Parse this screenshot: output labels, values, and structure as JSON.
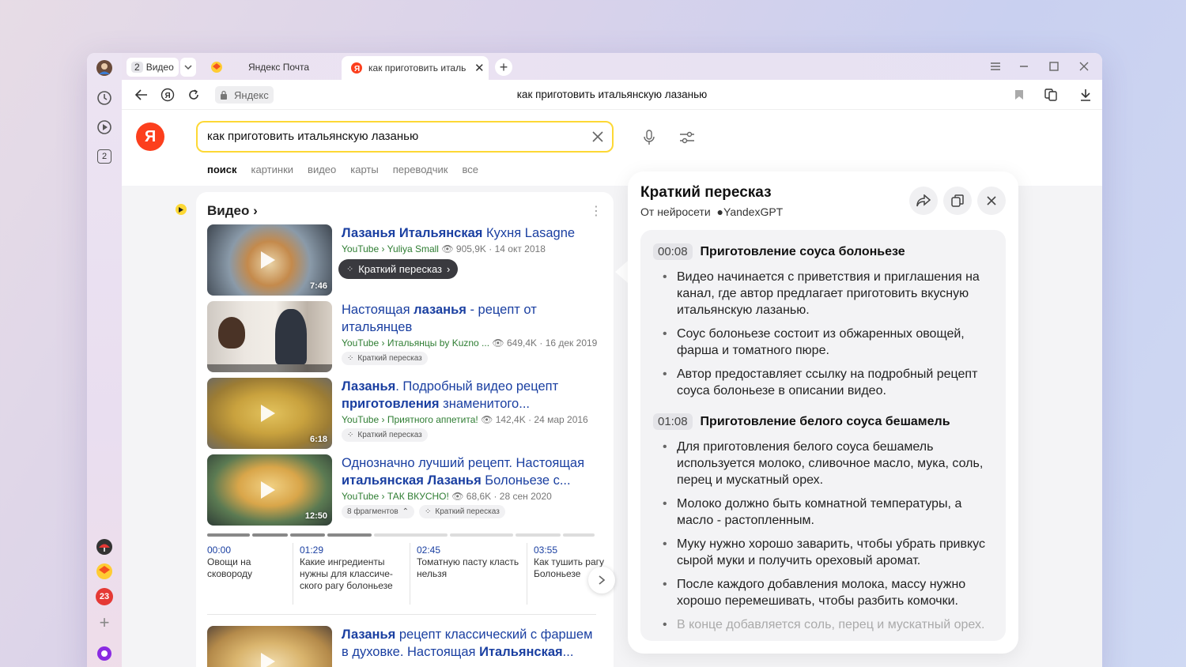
{
  "tabs": {
    "group_count": "2",
    "group_label": "Видео",
    "mail_label": "Яндекс Почта",
    "active_label": "как приготовить италь"
  },
  "address": {
    "site_label": "Яндекс",
    "query_title": "как приготовить итальянскую лазанью"
  },
  "rail": {
    "tab_count": "2",
    "badge_count": "23"
  },
  "search": {
    "value": "как приготовить итальянскую лазанью",
    "tabs": [
      "поиск",
      "картинки",
      "видео",
      "карты",
      "переводчик",
      "все"
    ]
  },
  "videos": {
    "header": "Видео",
    "items": [
      {
        "title_bold": "Лазанья Итальянская",
        "title_rest": " Кухня Lasagne",
        "source": "YouTube › Yuliya Small",
        "views": "905,9K",
        "date": "14 окт 2018",
        "duration": "7:46",
        "summary_label": "Краткий пересказ"
      },
      {
        "title_pre": "Настоящая ",
        "title_bold": "лазанья",
        "title_rest": " - рецепт от итальянцев",
        "source": "YouTube › Итальянцы by Kuzno ...",
        "views": "649,4K",
        "date": "16 дек 2019",
        "summary_label": "Краткий пересказ"
      },
      {
        "title_bold": "Лазанья",
        "title_rest": ". Подробный видео рецепт ",
        "title_bold2": "приготовления",
        "title_rest2": " знаменитого...",
        "source": "YouTube › Приятного аппетита!",
        "views": "142,4K",
        "date": "24 мар 2016",
        "duration": "6:18",
        "summary_label": "Краткий пересказ"
      },
      {
        "title_pre": "Однозначно лучший рецепт. Настоящая ",
        "title_bold": "итальянская Лазанья",
        "title_rest": " Болоньезе с...",
        "source": "YouTube › ТАК ВКУСНО!",
        "views": "68,6K",
        "date": "28 сен 2020",
        "duration": "12:50",
        "fragments_label": "8 фрагментов",
        "summary_label": "Краткий пересказ"
      },
      {
        "title_bold": "Лазанья",
        "title_rest": " рецепт классический с фаршем в духовке. Настоящая ",
        "title_bold2": "Итальянская",
        "title_rest2": "..."
      }
    ],
    "fragments": [
      {
        "time": "00:00",
        "text": "Овощи на сковороду"
      },
      {
        "time": "01:29",
        "text": "Какие ингредиенты нужны для классиче-ского рагу болоньезе"
      },
      {
        "time": "02:45",
        "text": "Томатную пасту класть нельзя"
      },
      {
        "time": "03:55",
        "text": "Как тушить рагу Болоньезе"
      }
    ]
  },
  "summary": {
    "title": "Краткий пересказ",
    "subtitle_prefix": "От нейросети",
    "subtitle_brand": "YandexGPT",
    "sections": [
      {
        "time": "00:08",
        "heading": "Приготовление соуса болоньезе",
        "bullets": [
          "Видео начинается с приветствия и приглашения на канал, где автор предлагает приготовить вкусную итальянскую лазанью.",
          "Соус болоньезе состоит из обжаренных овощей, фарша и томатного пюре.",
          "Автор предоставляет ссылку на подробный рецепт соуса болоньезе в описании видео."
        ]
      },
      {
        "time": "01:08",
        "heading": "Приготовление белого соуса бешамель",
        "bullets": [
          "Для приготовления белого соуса бешамель используется молоко, сливочное масло, мука, соль, перец и мускатный орех.",
          "Молоко должно быть комнатной температуры, а масло - растопленным.",
          "Муку нужно хорошо заварить, чтобы убрать привкус сырой муки и получить ореховый аромат.",
          "После каждого добавления молока, массу нужно хорошо перемешивать, чтобы разбить комочки.",
          "В конце добавляется соль, перец и мускатный орех."
        ]
      }
    ]
  },
  "colors": {
    "accent_yellow": "#fdd835",
    "link_blue": "#1a3fa1",
    "source_green": "#2e7d32",
    "yandex_red": "#fc3f1d"
  }
}
